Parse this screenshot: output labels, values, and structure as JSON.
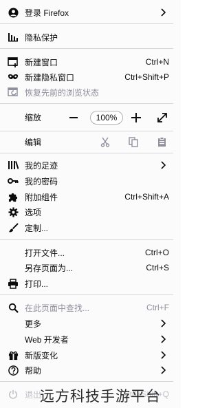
{
  "menu": {
    "signin": "登录 Firefox",
    "privacy": "隐私保护",
    "new_window": {
      "label": "新建窗口",
      "shortcut": "Ctrl+N"
    },
    "new_private_window": {
      "label": "新建隐私窗口",
      "shortcut": "Ctrl+Shift+P"
    },
    "restore_session": "恢复先前的浏览状态",
    "zoom": {
      "label": "缩放",
      "value": "100%"
    },
    "edit": {
      "label": "编辑"
    },
    "library": "我的足迹",
    "logins": "我的密码",
    "addons": {
      "label": "附加组件",
      "shortcut": "Ctrl+Shift+A"
    },
    "options": "选项",
    "customize": "定制...",
    "open_file": {
      "label": "打开文件...",
      "shortcut": "Ctrl+O"
    },
    "save_page": {
      "label": "另存页面为...",
      "shortcut": "Ctrl+S"
    },
    "print": "打印...",
    "find": {
      "label": "在此页面中查找...",
      "shortcut": "Ctrl+F"
    },
    "more": "更多",
    "web_developer": "Web 开发者",
    "whats_new": "新版变化",
    "help": "帮助",
    "quit": {
      "label": "退出",
      "shortcut": "Ctrl+Shift+Q"
    }
  },
  "watermark": "远方科技手游平台",
  "colors": {
    "text": "#0c0c0d",
    "disabled": "#8f8f9d",
    "separator": "#d7d7db",
    "background": "#fbfbfb"
  }
}
